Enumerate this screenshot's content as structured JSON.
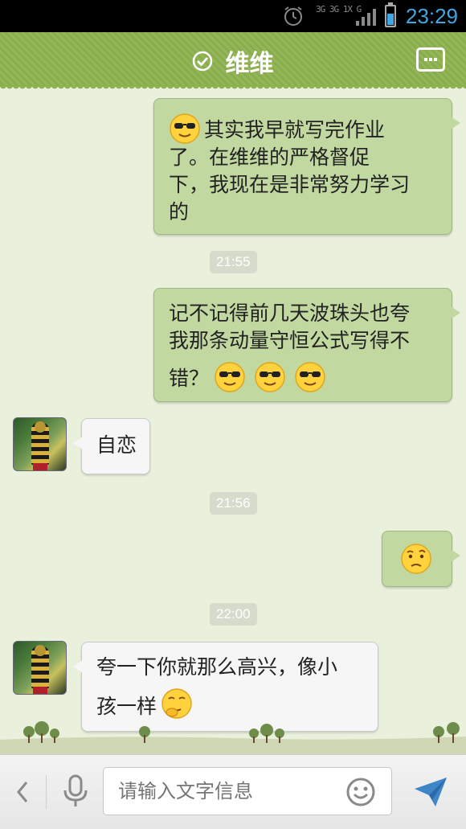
{
  "status_bar": {
    "network_label": "3G 3G 1X G",
    "time": "23:29"
  },
  "header": {
    "title": "维维",
    "more_icon": "more-icon",
    "verified_icon": "check-circle-icon"
  },
  "messages": [
    {
      "direction": "out",
      "text": "其实我早就写完作业了。在维维的严格督促下，我现在是非常努力学习的",
      "emojis": [
        "cool-sunglasses-emoji"
      ]
    },
    {
      "type": "time",
      "text": "21:55"
    },
    {
      "direction": "out",
      "text": "记不记得前几天波珠头也夸我那条动量守恒公式写得不错？",
      "emojis": [
        "cool-sunglasses-emoji",
        "cool-sunglasses-emoji",
        "cool-sunglasses-emoji"
      ]
    },
    {
      "direction": "in",
      "text": "自恋"
    },
    {
      "type": "time",
      "text": "21:56"
    },
    {
      "direction": "out",
      "text": "",
      "emojis": [
        "confused-emoji"
      ]
    },
    {
      "type": "time",
      "text": "22:00"
    },
    {
      "direction": "in",
      "text": "夸一下你就那么高兴，像小孩一样",
      "emojis": [
        "thinking-emoji"
      ]
    }
  ],
  "bubbles": {
    "m1_line1": "其实我早就写完作业",
    "m1_line2": "了。在维维的严格督促",
    "m1_line3": "下，我现在是非常努力学习",
    "m1_line4": "的",
    "m2_line1": "记不记得前几天波珠头也夸",
    "m2_line2": "我那条动量守恒公式写得不",
    "m2_line3": "错？",
    "m3": "自恋",
    "m5_line1": "夸一下你就那么高兴，像小",
    "m5_line2": "孩一样"
  },
  "timestamps": {
    "t1": "21:55",
    "t2": "21:56",
    "t3": "22:00"
  },
  "input_bar": {
    "placeholder": "请输入文字信息"
  },
  "colors": {
    "header_green": "#8db24f",
    "outgoing_bubble": "#c1d8a0",
    "incoming_bubble": "#f6f6f6",
    "clock_blue": "#3fa7e3"
  }
}
